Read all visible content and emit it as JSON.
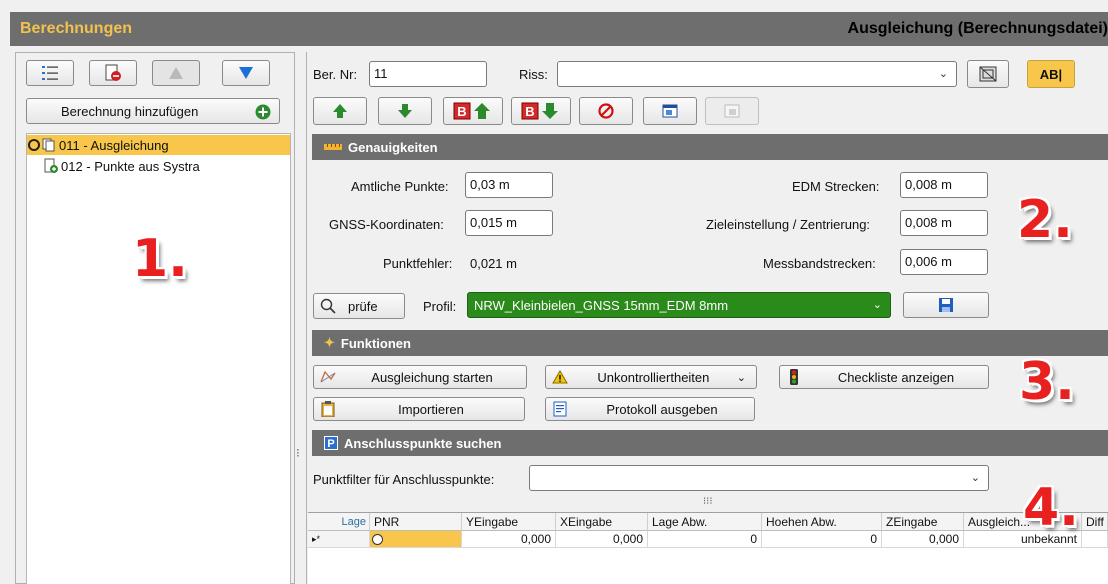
{
  "window": {
    "left_title": "Berechnungen",
    "right_title": "Ausgleichung (Berechnungsdatei)"
  },
  "left": {
    "add_button": "Berechnung hinzufügen",
    "tree": [
      {
        "label": "011 -  Ausgleichung",
        "selected": true
      },
      {
        "label": "012 - Punkte aus Systra",
        "selected": false
      }
    ],
    "marker": "1."
  },
  "header": {
    "ber_nr_label": "Ber. Nr:",
    "ber_nr_value": "11",
    "riss_label": "Riss:",
    "riss_value": "",
    "ab_button": "AB|"
  },
  "genauigkeiten": {
    "title": "Genauigkeiten",
    "amtliche_label": "Amtliche Punkte:",
    "amtliche_value": "0,03 m",
    "gnss_label": "GNSS-Koordinaten:",
    "gnss_value": "0,015 m",
    "punktfehler_label": "Punktfehler:",
    "punktfehler_value": "0,021 m",
    "edm_label": "EDM Strecken:",
    "edm_value": "0,008 m",
    "ziel_label": "Zieleinstellung / Zentrierung:",
    "ziel_value": "0,008 m",
    "mess_label": "Messbandstrecken:",
    "mess_value": "0,006 m",
    "pruefe_button": "prüfe",
    "profil_label": "Profil:",
    "profil_value": "NRW_Kleinbielen_GNSS 15mm_EDM 8mm",
    "profil_color": "#2a8a1a",
    "marker": "2."
  },
  "funktionen": {
    "title": "Funktionen",
    "ausgleichung_button": "Ausgleichung starten",
    "unkontrol_button": "Unkontrolliertheiten",
    "checkliste_button": "Checkliste anzeigen",
    "importieren_button": "Importieren",
    "protokoll_button": "Protokoll ausgeben",
    "marker": "3."
  },
  "anschluss": {
    "title": "Anschlusspunkte suchen",
    "filter_label": "Punktfilter für Anschlusspunkte:",
    "filter_value": "",
    "marker": "4."
  },
  "grid": {
    "columns": [
      "Lage",
      "PNR",
      "YEingabe",
      "XEingabe",
      "Lage Abw.",
      "Hoehen Abw.",
      "ZEingabe",
      "Ausgleich...",
      "Diff"
    ],
    "row": {
      "indicator": "▸*",
      "pnr": "",
      "yeingabe": "0,000",
      "xeingabe": "0,000",
      "lage_abw": "0",
      "hoehen_abw": "0",
      "zeingabe": "0,000",
      "ausgleich": "unbekannt",
      "diff": ""
    }
  },
  "colors": {
    "accent": "#f7c64a",
    "section_bg": "#6e6e6e",
    "title_yellow": "#f2c14e",
    "marker_red": "#e8201f"
  }
}
